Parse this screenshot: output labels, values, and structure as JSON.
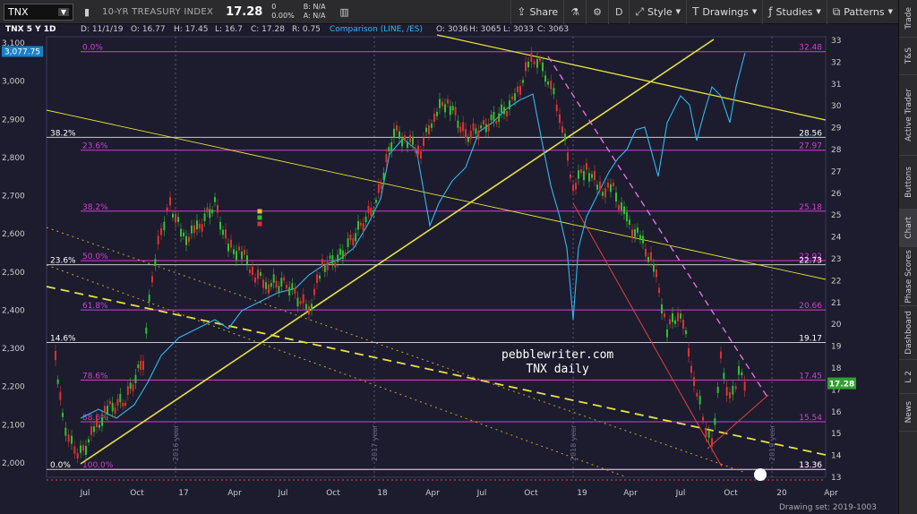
{
  "toolbar": {
    "symbol": "TNX",
    "name": "10-YR TREASURY INDEX",
    "last": "17.28",
    "change": "0",
    "change_pct": "0.00%",
    "bid": "B: N/A",
    "ask": "A: N/A",
    "share": "Share",
    "aggregation": "D",
    "style": "Style",
    "drawings": "Drawings",
    "studies": "Studies",
    "patterns": "Patterns"
  },
  "sidebar": {
    "tabs": [
      "Trade",
      "T&S",
      "Active Trader",
      "Buttons",
      "Chart",
      "Phase Scores",
      "Dashboard",
      "L 2",
      "News"
    ]
  },
  "chart": {
    "header": "TNX 5 Y 1D",
    "date": "D: 11/1/19",
    "open": "O: 16.77",
    "high": "H: 17.45",
    "low": "L: 16.7",
    "close": "C: 17.28",
    "range": "R: 0.75",
    "comparison": "Comparison (LINE, /ES)",
    "cmp_open": "O: 3036",
    "cmp_high": "H: 3065",
    "cmp_low": "L: 3033",
    "cmp_close": "C: 3063",
    "current_price_label": "17.28",
    "comparison_price_label": "3,077.75",
    "watermark_line1": "pebblewriter.com",
    "watermark_line2": "TNX daily",
    "drawing_set": "Drawing set: 2019-1003"
  },
  "colors": {
    "background": "#1c1c2e",
    "fib": "#d040d0",
    "fib_white": "#e8e8e8",
    "trend_yellow": "#e8e040",
    "comparison_line": "#30b8f0",
    "candle_up": "#30c030",
    "candle_down": "#e03030",
    "trend_red": "#e04040"
  },
  "axes": {
    "left": [
      "3,100",
      "3,000",
      "2,900",
      "2,800",
      "2,700",
      "2,600",
      "2,500",
      "2,400",
      "2,300",
      "2,200",
      "2,100",
      "2,000"
    ],
    "right": [
      "33",
      "32",
      "31",
      "30",
      "29",
      "28",
      "27",
      "26",
      "25",
      "24",
      "23",
      "22",
      "21",
      "20",
      "19",
      "18",
      "17",
      "16",
      "15",
      "14",
      "13"
    ],
    "bottom": [
      "Jul",
      "Oct",
      "17",
      "Apr",
      "Jul",
      "Oct",
      "18",
      "Apr",
      "Jul",
      "Oct",
      "19",
      "Apr",
      "Jul",
      "Oct",
      "20",
      "Apr"
    ],
    "year_markers": [
      "2016 year",
      "2017 year",
      "2018 year",
      "2019 year"
    ]
  },
  "fib_levels": {
    "magenta": [
      {
        "pct": "0.0%",
        "value": "32.48"
      },
      {
        "pct": "23.6%",
        "value": "27.97"
      },
      {
        "pct": "38.2%",
        "value": "25.18"
      },
      {
        "pct": "50.0%",
        "value": "22.92"
      },
      {
        "pct": "61.8%",
        "value": "20.66"
      },
      {
        "pct": "78.6%",
        "value": "17.45"
      },
      {
        "pct": "88.6%",
        "value": "15.54"
      },
      {
        "pct": "100.0%",
        "value": "13.36"
      }
    ],
    "white": [
      {
        "pct": "38.2%",
        "value": "28.56"
      },
      {
        "pct": "23.6%",
        "value": "22.73"
      },
      {
        "pct": "14.6%",
        "value": "19.17"
      },
      {
        "pct": "0.0%",
        "value": "13.36"
      }
    ]
  }
}
